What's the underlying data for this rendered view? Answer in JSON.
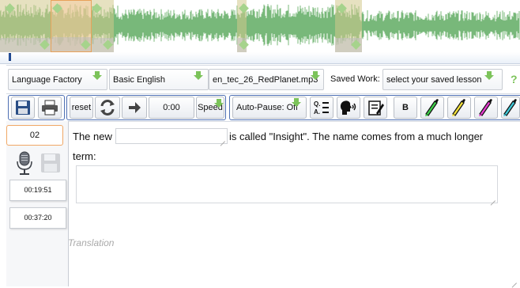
{
  "colors": {
    "waveform": "#78b87a",
    "segment_active_border": "#e8a25a",
    "accent_green": "#7cc35a",
    "toolbar_group_border": "#4d6fb3"
  },
  "selectors": {
    "source": "Language Factory",
    "course": "Basic English",
    "file": "en_tec_26_RedPlanet.mp3",
    "saved_work_label": "Saved Work:",
    "saved_work_value": "select your saved lesson",
    "help": "?"
  },
  "toolbar": {
    "save_icon": "floppy-disk-icon",
    "print_icon": "printer-icon",
    "reset": "reset",
    "loop_icon": "loop-icon",
    "next_icon": "arrow-right-icon",
    "time": "0:00",
    "speed": "Speed",
    "autopause": "Auto-Pause: Off",
    "qa_icon": "qa-icon",
    "speak_icon": "speaker-head-icon",
    "edit_icon": "edit-note-icon",
    "bold": "B",
    "highlighters": [
      "#3fcf4a",
      "#f4e23a",
      "#e63cd0",
      "#3fc8d8"
    ]
  },
  "left_panel": {
    "sentence_number": "02",
    "timestamps": [
      "00:19:51",
      "00:37:20"
    ]
  },
  "content": {
    "sentence_start": "The new",
    "sentence_rest": "is called \"Insight\". The name comes from a much longer",
    "sentence_end": "term:",
    "translation_placeholder": "Translation"
  }
}
